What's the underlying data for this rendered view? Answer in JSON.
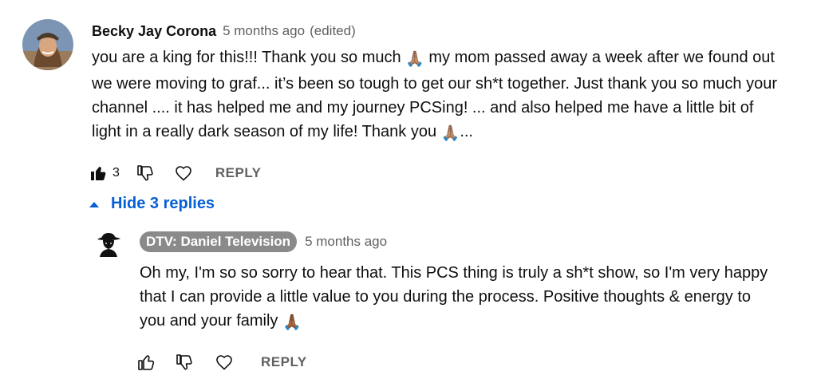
{
  "top_comment": {
    "author": "Becky Jay Corona",
    "timestamp": "5 months ago",
    "edited_label": "(edited)",
    "text_parts": [
      "you are a king for this!!! Thank you so much ",
      " my mom passed away a week after we found out we were moving to graf... it’s been so tough to get our sh*t together. Just thank you so much your channel .... it has helped me and my journey PCSing! ... and also helped me have a little bit of light in a really dark season of my life! Thank you ",
      "..."
    ],
    "emoji": "🙏🏽",
    "like_count": "3",
    "reply_label": "REPLY"
  },
  "replies_toggle": {
    "label": "Hide 3 replies"
  },
  "reply": {
    "author": "DTV: Daniel Television",
    "timestamp": "5 months ago",
    "text": "Oh my, I'm so so sorry to hear that.  This PCS thing is truly a sh*t show, so I'm very happy that I can provide a little value to you during the process.  Positive thoughts & energy to you and your family ",
    "emoji": "🙏🏾",
    "reply_label": "REPLY"
  },
  "colors": {
    "link_blue": "#065fd4",
    "secondary_text": "#606060",
    "author_badge_bg": "#8a8a8a"
  }
}
